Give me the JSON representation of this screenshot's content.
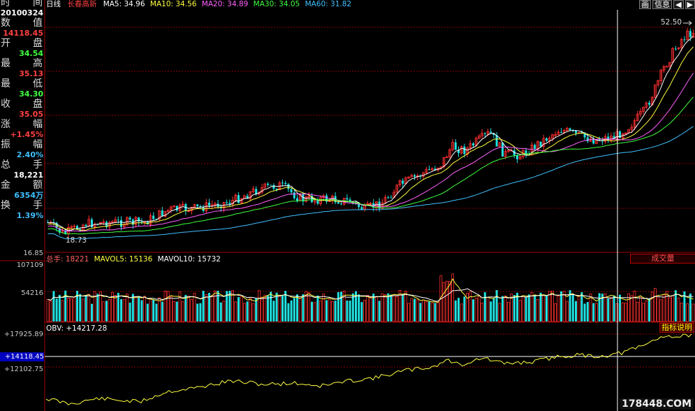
{
  "info_panel": {
    "rows": [
      {
        "a": "时",
        "b": "间",
        "value": "20100324",
        "color": "#ffffff"
      },
      {
        "a": "数",
        "b": "值",
        "value": "14118.45",
        "color": "#ff4040"
      },
      {
        "a": "开",
        "b": "盘",
        "value": "34.54",
        "color": "#40ff40"
      },
      {
        "a": "最",
        "b": "高",
        "value": "35.13",
        "color": "#ff4040"
      },
      {
        "a": "最",
        "b": "低",
        "value": "34.30",
        "color": "#40ff40"
      },
      {
        "a": "收",
        "b": "盘",
        "value": "35.05",
        "color": "#ff4040"
      },
      {
        "a": "涨",
        "b": "幅",
        "value": "+1.45%",
        "color": "#ff4040"
      },
      {
        "a": "振",
        "b": "幅",
        "value": "2.40%",
        "color": "#40c0ff"
      },
      {
        "a": "总",
        "b": "手",
        "value": "18,221",
        "color": "#ffffff"
      },
      {
        "a": "金",
        "b": "额",
        "value": "6354万",
        "color": "#40c0ff"
      },
      {
        "a": "换",
        "b": "手",
        "value": "1.39%",
        "color": "#40c0ff"
      }
    ]
  },
  "price_header": {
    "period": "日线",
    "stock": "长春高新",
    "ma": [
      {
        "label": "MA5: 34.96",
        "color": "#ffffff"
      },
      {
        "label": "MA10: 34.56",
        "color": "#ffff40"
      },
      {
        "label": "MA20: 34.89",
        "color": "#ff60ff"
      },
      {
        "label": "MA30: 34.05",
        "color": "#40ff40"
      },
      {
        "label": "MA60: 31.82",
        "color": "#40c0ff"
      }
    ]
  },
  "toolbar": {
    "btn1": "画",
    "btn2": "信息",
    "btn3": "◀",
    "btn4": "▶"
  },
  "price_axis": {
    "high_label": "52.50",
    "low_label": "18.73",
    "bottom_label": "16.85",
    "high_value": 52.5,
    "low_value": 18.73
  },
  "volume_header": {
    "total": "总手: 18221",
    "mavol5": "MAVOL5: 15136",
    "mavol10": "MAVOL10: 15732",
    "button": "成交量"
  },
  "volume_axis": {
    "top": "107109",
    "mid": "54216",
    "top_value": 107109
  },
  "obv_header": {
    "label": "OBV: +14217.28",
    "button": "指标说明"
  },
  "obv_axis": {
    "top": "+17925.89",
    "current": "+14118.45",
    "low": "+12102.75"
  },
  "watermark": "178448.COM",
  "colors": {
    "up": "#ff3030",
    "down": "#20e0e0",
    "ma5": "#ffffff",
    "ma10": "#ffff40",
    "ma20": "#ff60ff",
    "ma30": "#40ff40",
    "ma60": "#40c0ff",
    "obv": "#ffff40",
    "grid": "#900000"
  },
  "chart_data": {
    "type": "candlestick",
    "series": [
      {
        "name": "K线",
        "values": "daily OHLC, rising from 18.73 low to 52.50 high"
      },
      {
        "name": "成交量",
        "values": "daily volume bars"
      },
      {
        "name": "OBV",
        "values": "on balance volume line"
      }
    ],
    "ylim_price": [
      16.85,
      52.5
    ],
    "annotations": [
      "52.50",
      "18.73"
    ]
  }
}
